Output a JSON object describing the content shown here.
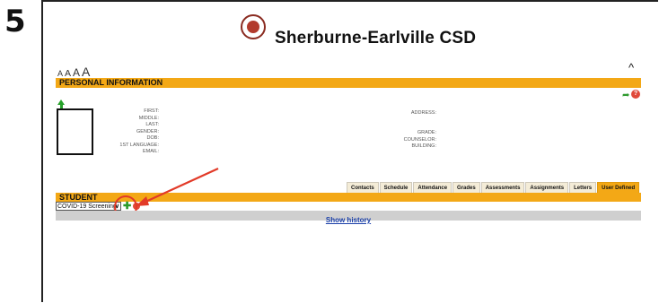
{
  "step_number": "5",
  "district_name": "Sherburne-Earlville CSD",
  "font_size_controls": [
    "A",
    "A",
    "A",
    "A"
  ],
  "collapse_symbol": "^",
  "personal_info_header": "PERSONAL INFORMATION",
  "left_labels": [
    "FIRST:",
    "MIDDLE:",
    "LAST:",
    "GENDER:",
    "DOB:",
    "1ST LANGUAGE:",
    "EMAIL:"
  ],
  "right_labels_top": [
    "ADDRESS:"
  ],
  "right_labels_bottom": [
    "GRADE:",
    "COUNSELOR:",
    "BUILDING:"
  ],
  "tabs": [
    "Contacts",
    "Schedule",
    "Attendance",
    "Grades",
    "Assessments",
    "Assignments",
    "Letters",
    "User Defined"
  ],
  "active_tab": "User Defined",
  "student_header": "STUDENT",
  "select_value": "COVID-19 Screening",
  "show_history": "Show history",
  "help_glyph": "?",
  "accent_color": "#f3a816",
  "annotation_color": "#e23a28"
}
